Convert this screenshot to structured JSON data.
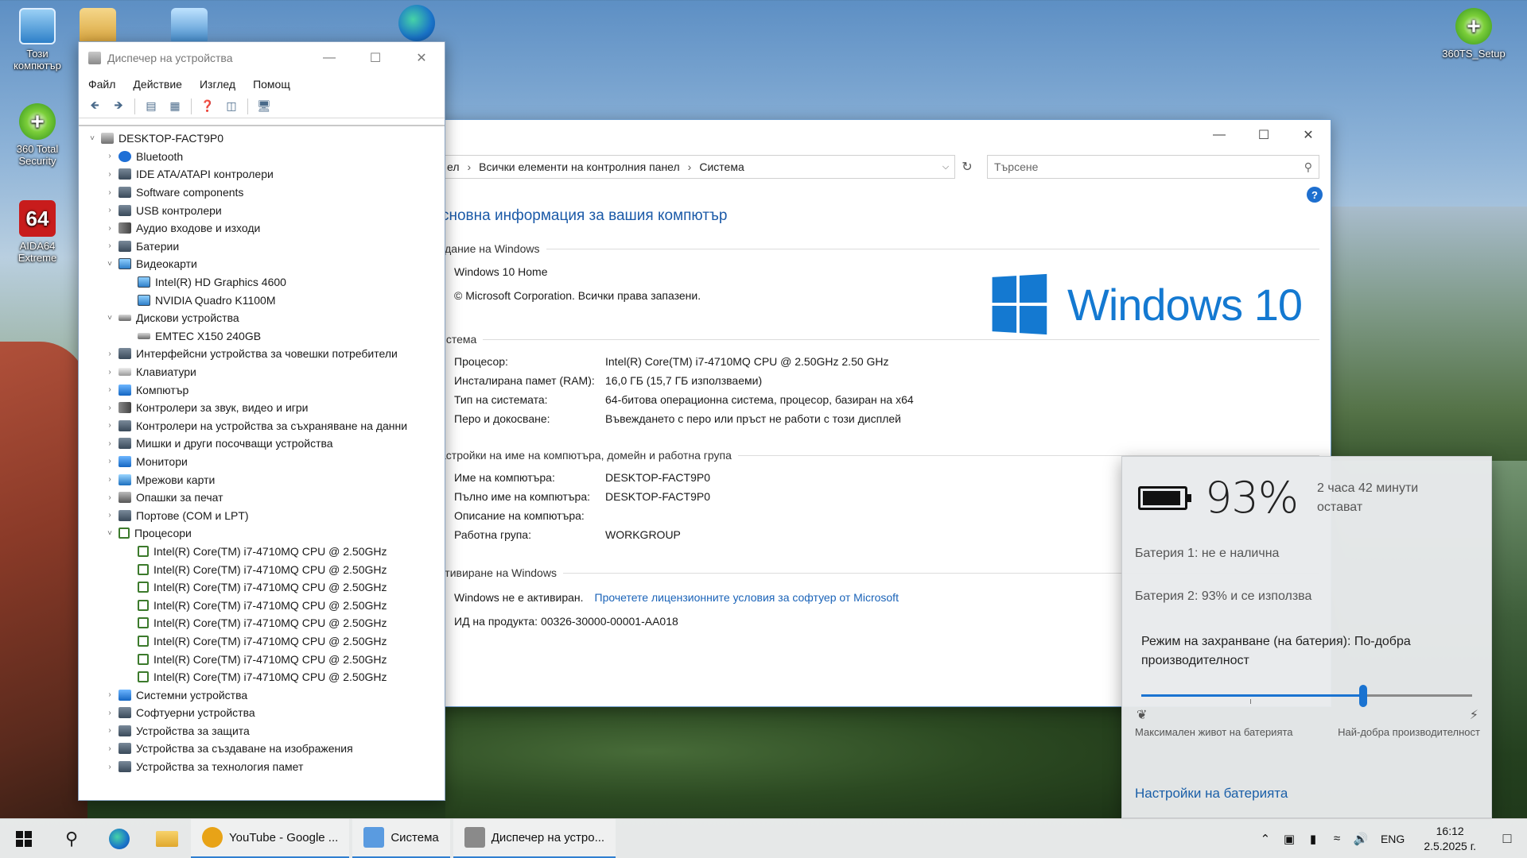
{
  "desktop": {
    "icons": [
      {
        "label": "Този компютър",
        "icon": "computer-icon"
      },
      {
        "label": "360 Total Security",
        "icon": "360-shield-icon"
      },
      {
        "label": "AIDA64 Extreme",
        "icon": "aida64-icon"
      },
      {
        "label": "360TS_Setup",
        "icon": "setup-shield-icon"
      }
    ],
    "aida_glyph": "64",
    "plus_glyph": "+"
  },
  "system_window": {
    "breadcrumb": [
      "ел",
      "Всички елементи на контролния панел",
      "Система"
    ],
    "search_placeholder": "Търсене",
    "help": "?",
    "page_title": "сновна информация за вашия компютър",
    "edition_head": "здание на Windows",
    "edition": "Windows 10 Home",
    "copyright": "© Microsoft Corporation. Всички права запазени.",
    "logo_text": "Windows 10",
    "system_head": "истема",
    "system_rows": [
      {
        "k": "Процесор:",
        "v": "Intel(R) Core(TM) i7-4710MQ CPU @ 2.50GHz   2.50 GHz"
      },
      {
        "k": "Инсталирана памет (RAM):",
        "v": "16,0 ГБ (15,7 ГБ използваеми)"
      },
      {
        "k": "Тип на системата:",
        "v": "64-битова операционна система, процесор, базиран на x64"
      },
      {
        "k": "Перо и докосване:",
        "v": "Въвеждането с перо или пръст не работи с този дисплей"
      }
    ],
    "name_head": "астройки на име на компютъра, домейн и работна група",
    "name_rows": [
      {
        "k": "Име на компютъра:",
        "v": "DESKTOP-FACT9P0"
      },
      {
        "k": "Пълно име на компютъра:",
        "v": "DESKTOP-FACT9P0"
      },
      {
        "k": "Описание на компютъра:",
        "v": ""
      },
      {
        "k": "Работна група:",
        "v": "WORKGROUP"
      }
    ],
    "activation_head": "ктивиране на Windows",
    "activation_status": "Windows не е активиран.",
    "activation_link": "Прочетете лицензионните условия за софтуер от Microsoft",
    "product_id": "ИД на продукта: 00326-30000-00001-AA018"
  },
  "device_manager": {
    "title": "Диспечер на устройства",
    "menu": [
      "Файл",
      "Действие",
      "Изглед",
      "Помощ"
    ],
    "tree": [
      {
        "level": 0,
        "label": "DESKTOP-FACT9P0",
        "chev": "˅",
        "icon": "i-comp"
      },
      {
        "level": 1,
        "label": "Bluetooth",
        "chev": "›",
        "icon": "i-bt"
      },
      {
        "level": 1,
        "label": "IDE ATA/ATAPI контролери",
        "chev": "›",
        "icon": "i-gen"
      },
      {
        "level": 1,
        "label": "Software components",
        "chev": "›",
        "icon": "i-gen"
      },
      {
        "level": 1,
        "label": "USB контролери",
        "chev": "›",
        "icon": "i-gen"
      },
      {
        "level": 1,
        "label": "Аудио входове и изходи",
        "chev": "›",
        "icon": "i-snd"
      },
      {
        "level": 1,
        "label": "Батерии",
        "chev": "›",
        "icon": "i-gen"
      },
      {
        "level": 1,
        "label": "Видеокарти",
        "chev": "˅",
        "icon": "i-mon"
      },
      {
        "level": 2,
        "label": "Intel(R) HD Graphics 4600",
        "chev": "",
        "icon": "i-mon"
      },
      {
        "level": 2,
        "label": "NVIDIA Quadro K1100M",
        "chev": "",
        "icon": "i-mon"
      },
      {
        "level": 1,
        "label": "Дискови устройства",
        "chev": "˅",
        "icon": "i-disk"
      },
      {
        "level": 2,
        "label": "EMTEC X150 240GB",
        "chev": "",
        "icon": "i-disk"
      },
      {
        "level": 1,
        "label": "Интерфейсни устройства за човешки потребители",
        "chev": "›",
        "icon": "i-gen"
      },
      {
        "level": 1,
        "label": "Клавиатури",
        "chev": "›",
        "icon": "i-kb"
      },
      {
        "level": 1,
        "label": "Компютър",
        "chev": "›",
        "icon": "i-blue"
      },
      {
        "level": 1,
        "label": "Контролери за звук, видео и игри",
        "chev": "›",
        "icon": "i-snd"
      },
      {
        "level": 1,
        "label": "Контролери на устройства за съхраняване на данни",
        "chev": "›",
        "icon": "i-gen"
      },
      {
        "level": 1,
        "label": "Мишки и други посочващи устройства",
        "chev": "›",
        "icon": "i-gen"
      },
      {
        "level": 1,
        "label": "Монитори",
        "chev": "›",
        "icon": "i-blue"
      },
      {
        "level": 1,
        "label": "Мрежови карти",
        "chev": "›",
        "icon": "i-net"
      },
      {
        "level": 1,
        "label": "Опашки за печат",
        "chev": "›",
        "icon": "i-prn"
      },
      {
        "level": 1,
        "label": "Портове (COM и LPT)",
        "chev": "›",
        "icon": "i-gen"
      },
      {
        "level": 1,
        "label": "Процесори",
        "chev": "˅",
        "icon": "i-cpu"
      },
      {
        "level": 2,
        "label": "Intel(R) Core(TM) i7-4710MQ CPU @ 2.50GHz",
        "chev": "",
        "icon": "i-cpu"
      },
      {
        "level": 2,
        "label": "Intel(R) Core(TM) i7-4710MQ CPU @ 2.50GHz",
        "chev": "",
        "icon": "i-cpu"
      },
      {
        "level": 2,
        "label": "Intel(R) Core(TM) i7-4710MQ CPU @ 2.50GHz",
        "chev": "",
        "icon": "i-cpu"
      },
      {
        "level": 2,
        "label": "Intel(R) Core(TM) i7-4710MQ CPU @ 2.50GHz",
        "chev": "",
        "icon": "i-cpu"
      },
      {
        "level": 2,
        "label": "Intel(R) Core(TM) i7-4710MQ CPU @ 2.50GHz",
        "chev": "",
        "icon": "i-cpu"
      },
      {
        "level": 2,
        "label": "Intel(R) Core(TM) i7-4710MQ CPU @ 2.50GHz",
        "chev": "",
        "icon": "i-cpu"
      },
      {
        "level": 2,
        "label": "Intel(R) Core(TM) i7-4710MQ CPU @ 2.50GHz",
        "chev": "",
        "icon": "i-cpu"
      },
      {
        "level": 2,
        "label": "Intel(R) Core(TM) i7-4710MQ CPU @ 2.50GHz",
        "chev": "",
        "icon": "i-cpu"
      },
      {
        "level": 1,
        "label": "Системни устройства",
        "chev": "›",
        "icon": "i-blue"
      },
      {
        "level": 1,
        "label": "Софтуерни устройства",
        "chev": "›",
        "icon": "i-gen"
      },
      {
        "level": 1,
        "label": "Устройства за защита",
        "chev": "›",
        "icon": "i-gen"
      },
      {
        "level": 1,
        "label": "Устройства за създаване на изображения",
        "chev": "›",
        "icon": "i-gen"
      },
      {
        "level": 1,
        "label": "Устройства за технология памет",
        "chev": "›",
        "icon": "i-gen"
      }
    ]
  },
  "battery": {
    "percent_text": "93%",
    "level": 0.93,
    "remaining": "2 часа 42 минути остават",
    "battery1": "Батерия 1: не е налична",
    "battery2": "Батерия 2: 93% и се използва",
    "mode": "Режим на захранване (на батерия): По-добра производителност",
    "slider_value": 0.67,
    "label_left": "Максимален живот на батерията",
    "label_right": "Най-добра производителност",
    "settings_link": "Настройки на батерията"
  },
  "taskbar": {
    "apps": [
      {
        "label": "YouTube - Google ...",
        "color": "#e8a317"
      },
      {
        "label": "Система",
        "color": "#5a9be0"
      },
      {
        "label": "Диспечер на устро...",
        "color": "#8a8a8a"
      }
    ],
    "lang": "ENG",
    "time": "16:12",
    "date": "2.5.2025 г."
  },
  "colors": {
    "accent": "#1479d1",
    "link": "#1a63b8"
  }
}
